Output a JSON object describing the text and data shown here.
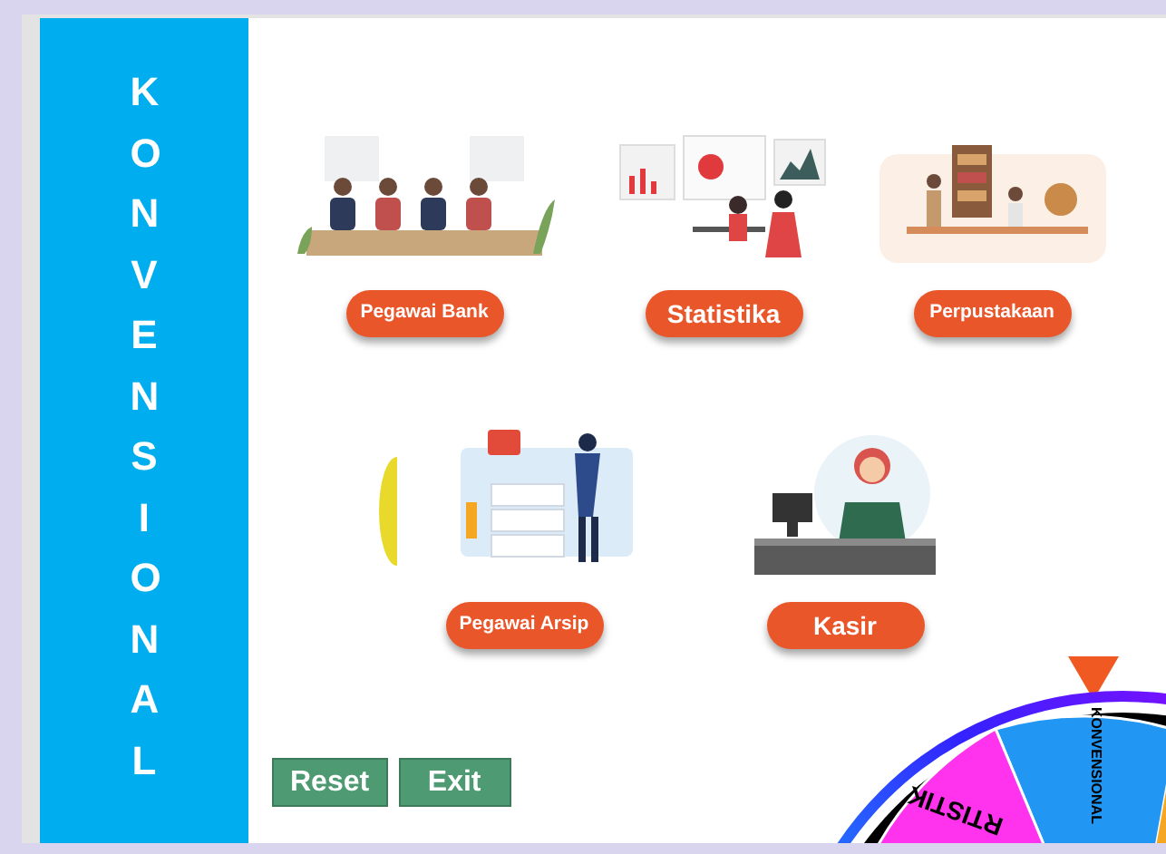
{
  "sidebar": {
    "title": "KONVENSIONAL"
  },
  "careers": [
    {
      "label": "Pegawai Bank",
      "kind": "bank"
    },
    {
      "label": "Statistika",
      "kind": "stats"
    },
    {
      "label": "Perpustakaan",
      "kind": "library"
    },
    {
      "label": "Pegawai Arsip",
      "kind": "archive"
    },
    {
      "label": "Kasir",
      "kind": "cashier"
    }
  ],
  "buttons": [
    {
      "label": "Reset"
    },
    {
      "label": "Exit"
    }
  ],
  "wheel": {
    "segments": [
      {
        "label": "KONVENSIONAL",
        "color": "#2196f3"
      },
      {
        "label": "RTISTIK",
        "color": "#ff33ee"
      }
    ]
  }
}
